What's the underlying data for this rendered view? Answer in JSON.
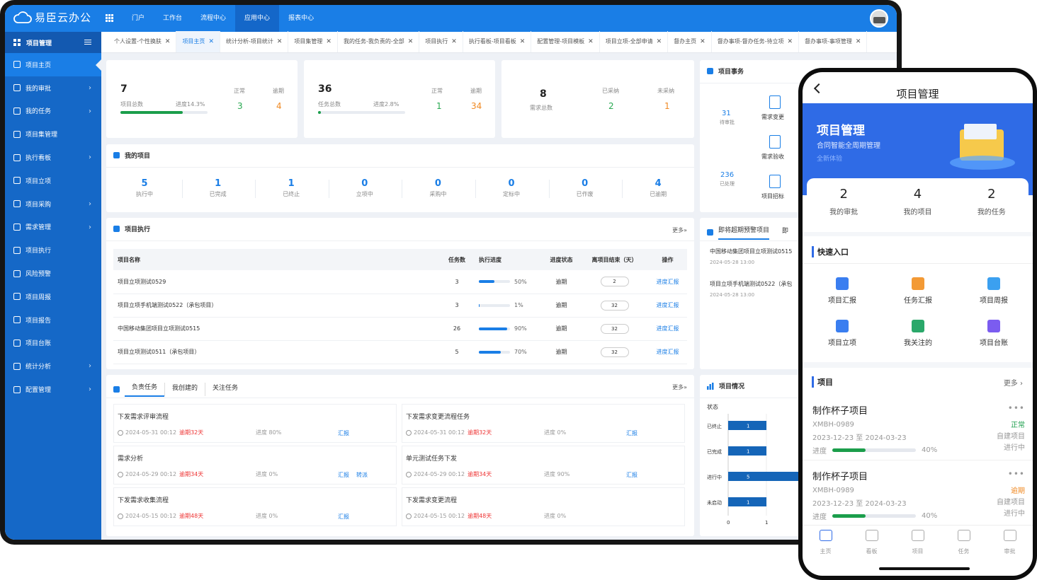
{
  "app": {
    "name": "易臣云办公",
    "nav": [
      "门户",
      "工作台",
      "流程中心",
      "应用中心",
      "报表中心"
    ],
    "nav_active": 3
  },
  "sidebar": {
    "title": "项目管理",
    "items": [
      {
        "label": "项目主页",
        "arrow": false,
        "icon": "home-icon"
      },
      {
        "label": "我的审批",
        "arrow": true,
        "icon": "approval-icon"
      },
      {
        "label": "我的任务",
        "arrow": true,
        "icon": "task-icon"
      },
      {
        "label": "项目集管理",
        "arrow": false,
        "icon": "cube-icon"
      },
      {
        "label": "执行看板",
        "arrow": true,
        "icon": "link-icon"
      },
      {
        "label": "项目立项",
        "arrow": false,
        "icon": "cube-icon"
      },
      {
        "label": "项目采购",
        "arrow": true,
        "icon": "cube-icon"
      },
      {
        "label": "需求管理",
        "arrow": true,
        "icon": "cube-icon"
      },
      {
        "label": "项目执行",
        "arrow": false,
        "icon": "doc-icon"
      },
      {
        "label": "风险预警",
        "arrow": false,
        "icon": "shield-icon"
      },
      {
        "label": "项目周报",
        "arrow": false,
        "icon": "report-icon"
      },
      {
        "label": "项目报告",
        "arrow": false,
        "icon": "cube-icon"
      },
      {
        "label": "项目台账",
        "arrow": false,
        "icon": "ledger-icon"
      },
      {
        "label": "统计分析",
        "arrow": true,
        "icon": "chart-icon"
      },
      {
        "label": "配置管理",
        "arrow": true,
        "icon": "people-icon"
      }
    ]
  },
  "tabs": [
    "个人设置-个性换肤",
    "项目主页",
    "统计分析-项目统计",
    "项目集管理",
    "我的任务-我负责的-全部",
    "项目执行",
    "执行看板-项目看板",
    "配置管理-项目模板",
    "项目立项-全部申请",
    "督办主页",
    "督办事项-督办任务-待立项",
    "督办事项-事项管理"
  ],
  "tab_active": 1,
  "summary": {
    "projects": {
      "total": "7",
      "total_label": "项目总数",
      "progress": "进度14.3%",
      "normal_label": "正常",
      "normal": "3",
      "overdue_label": "逾期",
      "overdue": "4",
      "progress_value": 0.143
    },
    "tasks": {
      "total": "36",
      "total_label": "任务总数",
      "progress": "进度2.8%",
      "normal_label": "正常",
      "normal": "1",
      "overdue_label": "逾期",
      "overdue": "34",
      "progress_value": 0.028
    },
    "demands": {
      "total": "8",
      "total_label": "需求总数",
      "adopted_label": "已采纳",
      "adopted": "2",
      "rejected_label": "未采纳",
      "rejected": "1"
    }
  },
  "affairs": {
    "title": "项目事务",
    "pending": "31",
    "pending_label": "待审批",
    "done": "236",
    "done_label": "已处理",
    "actions": [
      "需求变更",
      "需求验收",
      "项目招标"
    ]
  },
  "my_projects": {
    "title": "我的项目",
    "stats": [
      {
        "n": "5",
        "l": "执行中"
      },
      {
        "n": "1",
        "l": "已完成"
      },
      {
        "n": "1",
        "l": "已终止"
      },
      {
        "n": "0",
        "l": "立项中"
      },
      {
        "n": "0",
        "l": "采购中"
      },
      {
        "n": "0",
        "l": "定标中"
      },
      {
        "n": "0",
        "l": "已作废"
      },
      {
        "n": "4",
        "l": "已逾期"
      }
    ]
  },
  "execution": {
    "title": "项目执行",
    "more": "更多»",
    "headers": [
      "项目名称",
      "任务数",
      "执行进度",
      "进度状态",
      "离项目结束（天）",
      "操作"
    ],
    "rows": [
      {
        "name": "项目立项测试0529",
        "tasks": "3",
        "progress": "50%",
        "pv": 0.5,
        "status": "逾期",
        "days": "2",
        "op": "进度汇报"
      },
      {
        "name": "项目立项手机端测试0522（承包项目）",
        "tasks": "3",
        "progress": "1%",
        "pv": 0.01,
        "status": "逾期",
        "days": "32",
        "op": "进度汇报"
      },
      {
        "name": "中国移动集团项目立项测试0515",
        "tasks": "26",
        "progress": "90%",
        "pv": 0.9,
        "status": "逾期",
        "days": "32",
        "op": "进度汇报"
      },
      {
        "name": "项目立项测试0511（承包项目）",
        "tasks": "5",
        "progress": "70%",
        "pv": 0.7,
        "status": "逾期",
        "days": "32",
        "op": "进度汇报"
      }
    ]
  },
  "warning": {
    "tab1": "即将超期预警项目",
    "tab2": "即",
    "items": [
      {
        "name": "中国移动集团项目立项测试0515",
        "time": "2024-05-28 13:00"
      },
      {
        "name": "项目立项手机端测试0522（承包",
        "time": "2024-05-28 13:00"
      }
    ]
  },
  "tasks": {
    "tabs": [
      "负责任务",
      "我创建的",
      "关注任务"
    ],
    "more": "更多»",
    "items": [
      {
        "title": "下发需求评审流程",
        "time": "2024-05-31 00:12",
        "overdue": "逾期32天",
        "progress": "进度 80%",
        "act1": "汇报",
        "act2": ""
      },
      {
        "title": "下发需求变更流程任务",
        "time": "2024-05-31 00:12",
        "overdue": "逾期32天",
        "progress": "进度 0%",
        "act1": "汇报",
        "act2": ""
      },
      {
        "title": "需求分析",
        "time": "2024-05-29 00:12",
        "overdue": "逾期34天",
        "progress": "进度 0%",
        "act1": "汇报",
        "act2": "转派"
      },
      {
        "title": "单元测试任务下发",
        "time": "2024-05-29 00:12",
        "overdue": "逾期34天",
        "progress": "进度 90%",
        "act1": "汇报",
        "act2": ""
      },
      {
        "title": "下发需求收集流程",
        "time": "2024-05-15 00:12",
        "overdue": "逾期48天",
        "progress": "进度 0%",
        "act1": "汇报",
        "act2": ""
      },
      {
        "title": "下发需求变更流程",
        "time": "2024-05-15 00:12",
        "overdue": "逾期48天",
        "progress": "进度 0%",
        "act1": "",
        "act2": ""
      }
    ]
  },
  "chart_data": {
    "type": "bar",
    "title": "项目情况",
    "ylabel": "状态",
    "categories": [
      "已终止",
      "已完成",
      "进行中",
      "未启动"
    ],
    "values": [
      1,
      1,
      5,
      1
    ],
    "xticks": [
      "0",
      "1"
    ],
    "color": "#1565b8"
  },
  "phone": {
    "title": "项目管理",
    "banner_title": "项目管理",
    "banner_sub": "合同智能全周期管理",
    "banner_sub2": "全新体验",
    "stats": [
      {
        "n": "2",
        "l": "我的审批"
      },
      {
        "n": "4",
        "l": "我的项目"
      },
      {
        "n": "2",
        "l": "我的任务"
      }
    ],
    "quick_title": "快速入口",
    "quick": [
      {
        "l": "项目汇报",
        "c": "#3a7ef0"
      },
      {
        "l": "任务汇报",
        "c": "#f39a35"
      },
      {
        "l": "项目周报",
        "c": "#3ba0f0"
      },
      {
        "l": "项目立项",
        "c": "#3a7ef0"
      },
      {
        "l": "我关注的",
        "c": "#2aa86a"
      },
      {
        "l": "项目台账",
        "c": "#7b5cf0"
      }
    ],
    "proj_title": "项目",
    "more": "更多 ›",
    "projects": [
      {
        "name": "制作杯子项目",
        "code": "XMBH-0989",
        "date": "2023-12-23 至 2024-03-23",
        "prog_label": "进度",
        "prog": "40%",
        "pv": 0.4,
        "status": "正常",
        "type": "自建项目",
        "state": "进行中"
      },
      {
        "name": "制作杯子项目",
        "code": "XMBH-0989",
        "date": "2023-12-23 至 2024-03-23",
        "prog_label": "进度",
        "prog": "40%",
        "pv": 0.4,
        "status": "逾期",
        "type": "自建项目",
        "state": "进行中"
      }
    ],
    "tabbar": [
      "主页",
      "看板",
      "项目",
      "任务",
      "审批"
    ]
  }
}
